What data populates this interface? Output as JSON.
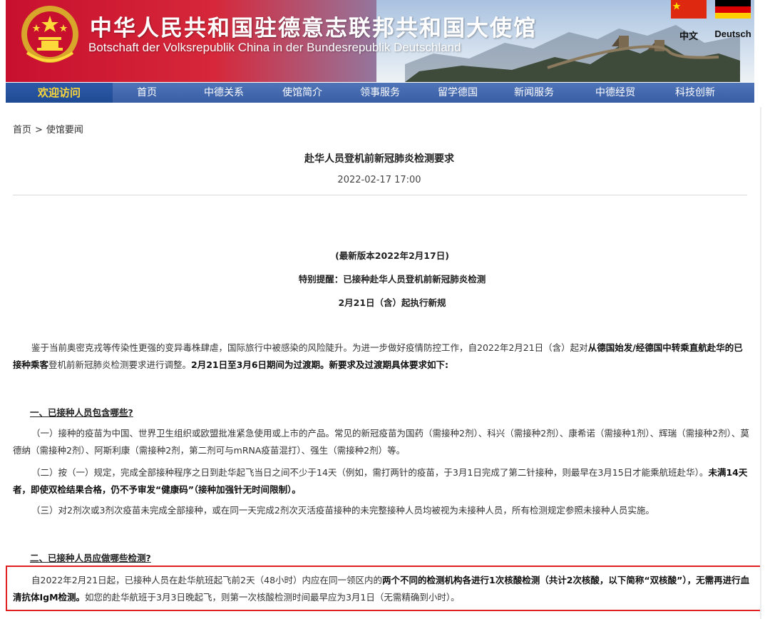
{
  "header": {
    "title_zh": "中华人民共和国驻德意志联邦共和国大使馆",
    "title_de": "Botschaft der Volksrepublik China in der Bundesrepublik Deutschland",
    "emblem_icon": "national-emblem-icon",
    "languages": [
      {
        "label": "中文",
        "flag": "china-flag-icon"
      },
      {
        "label": "Deutsch",
        "flag": "germany-flag-icon"
      }
    ]
  },
  "nav": {
    "items": [
      "欢迎访问",
      "首页",
      "中德关系",
      "使馆简介",
      "领事服务",
      "留学德国",
      "新闻服务",
      "中德经贸",
      "科技创新"
    ],
    "active_index": 0,
    "colors": {
      "bar": "#3a5ea4",
      "active_text": "#ffd83a"
    }
  },
  "breadcrumb": {
    "home": "首页",
    "separator": ">",
    "current": "使馆要闻"
  },
  "article": {
    "title": "赴华人员登机前新冠肺炎检测要求",
    "date": "2022-02-17 17:00",
    "version": "(最新版本2022年2月17日)",
    "reminder": "特别提醒：已接种赴华人员登机前新冠肺炎检测",
    "effective": "2月21日（含）起执行新规",
    "intro_1": "鉴于当前奥密克戎等传染性更强的变异毒株肆虐，国际旅行中被感染的风险陡升。为进一步做好疫情防控工作，自2022年2月21日（含）起对",
    "intro_bold_1": "从德国始发/经德国中转乘直航赴华的已接种乘客",
    "intro_2": "登机前新冠肺炎检测要求进行调整。",
    "intro_bold_2": "2月21日至3月6日期间为过渡期。新要求及过渡期具体要求如下:",
    "section1_title": "一、已接种人员包含哪些?",
    "s1_p1": "（一）接种的疫苗为中国、世界卫生组织或欧盟批准紧急使用或上市的产品。常见的新冠疫苗为国药（需接种2剂）、科兴（需接种2剂）、康希诺（需接种1剂）、辉瑞（需接种2剂）、莫德纳（需接种2剂）、阿斯利康（需接种2剂，第二剂可与mRNA疫苗混打）、强生（需接种2剂）等。",
    "s1_p2": "（二）按（一）规定，完成全部接种程序之日到赴华起飞当日之间不少于14天（例如，需打两针的疫苗，于3月1日完成了第二针接种，则最早在3月15日才能乘航班赴华）。",
    "s1_p2_bold": "未满14天者，即使双检结果合格，仍不予审发“健康码”（接种加强针无时间限制）。",
    "s1_p3": "（三）对2剂次或3剂次疫苗未完成全部接种，或在同一天完成2剂次灭活疫苗接种的未完整接种人员均被视为未接种人员，所有检测规定参照未接种人员实施。",
    "section2_title": "二、已接种人员应做哪些检测?",
    "s2_p1": "自2022年2月21日起，已接种人员在赴华航班起飞前2天（48小时）内应在同一领区内的",
    "s2_p1_bold": "两个不同的检测机构各进行1次核酸检测（共计2次核酸，以下简称“双核酸”），无需再进行血清抗体IgM检测。",
    "s2_p1_tail": "如您的赴华航班于3月3日晚起飞，则第一次核酸检测时间最早应为3月1日（无需精确到小时）。",
    "highlight_color": "#e02020"
  }
}
